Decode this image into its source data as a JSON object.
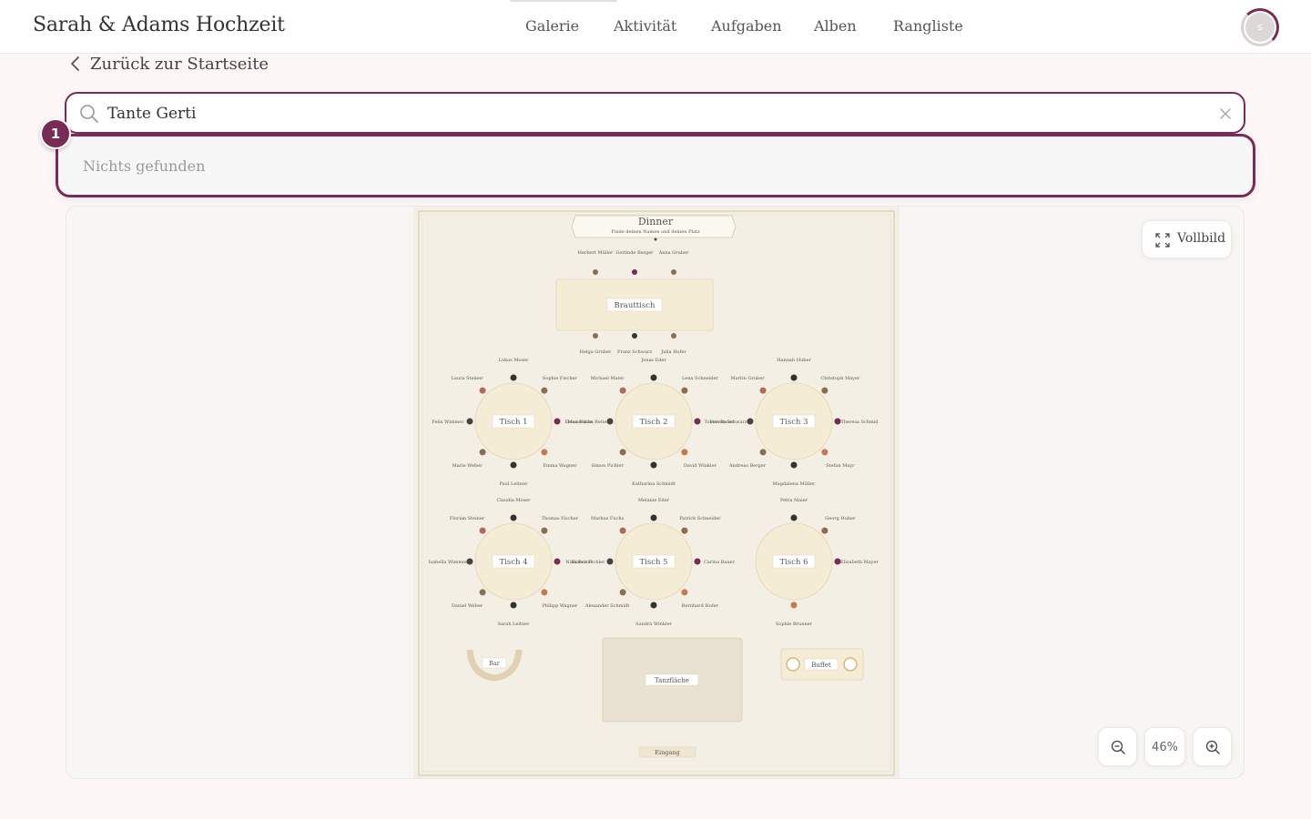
{
  "app": {
    "title": "Sarah & Adams Hochzeit"
  },
  "nav": [
    {
      "label": "Galerie"
    },
    {
      "label": "Aktivität"
    },
    {
      "label": "Aufgaben"
    },
    {
      "label": "Alben"
    },
    {
      "label": "Rangliste"
    }
  ],
  "user": {
    "initial": "s"
  },
  "back": {
    "label": "Zurück zur Startseite"
  },
  "search": {
    "value": "Tante Gerti",
    "results_empty": "Nichts gefunden",
    "badge": "1"
  },
  "map": {
    "title": "Dinner",
    "subtitle": "Finde deinen Namen und deinen Platz",
    "head_table": {
      "label": "Brauttisch",
      "top": [
        "Herbert Müller",
        "Gerlinde Berger",
        "Anna Gruber"
      ],
      "bottom": [
        "Helga Gruber",
        "Franz Schwarz",
        "Julia Hofer"
      ]
    },
    "tables": [
      {
        "label": "Tisch 1",
        "guests": [
          "Lukas Moser",
          "Sophie Fischer",
          "Elena Fuchs",
          "Emma Wagner",
          "Paul Leitner",
          "Marie Weber",
          "Felix Wimmer",
          "Laura Steiner"
        ]
      },
      {
        "label": "Tisch 2",
        "guests": [
          "Jonas Eder",
          "Lena Schneider",
          "Tobias Bauer",
          "David Winkler",
          "Katharina Schmidt",
          "Simon Pichler",
          "Maximilian Reiter",
          "Michael Maier"
        ]
      },
      {
        "label": "Tisch 3",
        "guests": [
          "Hannah Huber",
          "Christoph Mayer",
          "Theresa Schmid",
          "Stefan Mayr",
          "Magdalena Müller",
          "Andreas Berger",
          "Verena Schwarz",
          "Martin Gruber"
        ]
      },
      {
        "label": "Tisch 4",
        "guests": [
          "Claudia Moser",
          "Thomas Fischer",
          "Nina Reiter",
          "Philipp Wagner",
          "Sarah Leitner",
          "Daniel Weber",
          "Isabella Wimmer",
          "Florian Steiner"
        ]
      },
      {
        "label": "Tisch 5",
        "guests": [
          "Melanie Eder",
          "Patrick Schneider",
          "Carina Bauer",
          "Bernhard Hofer",
          "Sandra Winkler",
          "Alexander Schmidt",
          "Bianca Pichler",
          "Markus Fuchs"
        ]
      },
      {
        "label": "Tisch 6",
        "guests": [
          "Petra Maier",
          "Georg Huber",
          "Elisabeth Mayer",
          "Sophie Brunner"
        ]
      }
    ],
    "areas": {
      "bar": "Bar",
      "dance": "Tanzfläche",
      "buffet": "Buffet",
      "entrance": "Eingang"
    }
  },
  "controls": {
    "fullscreen": "Vollbild",
    "zoom": "46%"
  },
  "colors": {
    "accent": "#7a2b55",
    "background": "#fcf6f6",
    "map_paper": "#f3efe4"
  }
}
